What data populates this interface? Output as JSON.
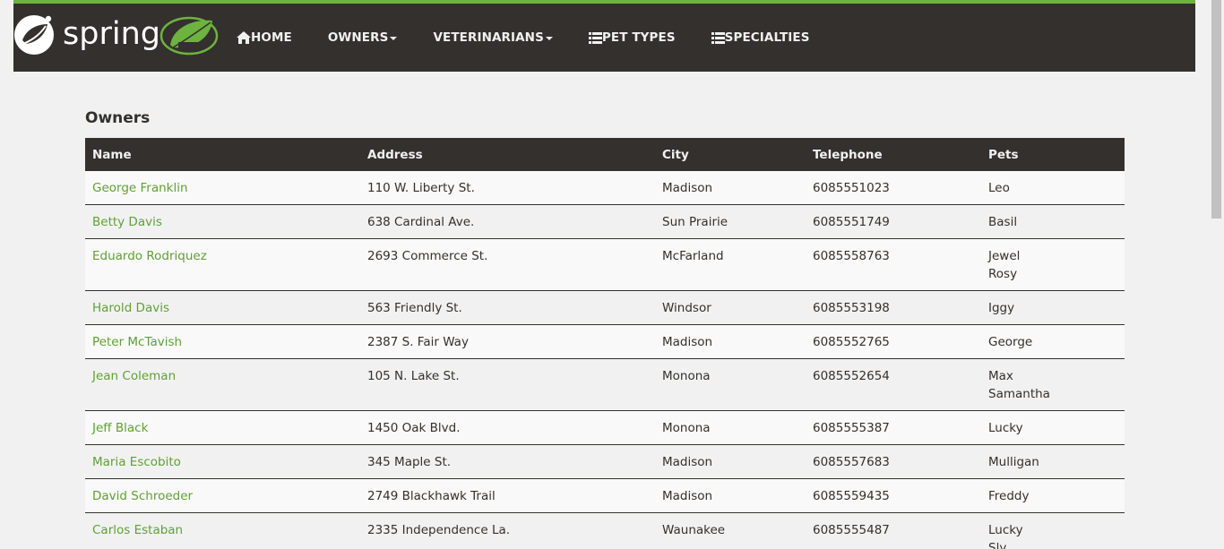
{
  "brand": {
    "wordmark": "spring"
  },
  "nav": {
    "items": [
      {
        "label": "HOME",
        "icon": "home-icon"
      },
      {
        "label": "OWNERS",
        "icon": "caret-down-icon"
      },
      {
        "label": "VETERINARIANS",
        "icon": "caret-down-icon"
      },
      {
        "label": "PET TYPES",
        "icon": "list-icon"
      },
      {
        "label": "SPECIALTIES",
        "icon": "list-icon"
      }
    ]
  },
  "page": {
    "title": "Owners"
  },
  "table": {
    "headers": [
      "Name",
      "Address",
      "City",
      "Telephone",
      "Pets"
    ],
    "rows": [
      {
        "name": "George Franklin",
        "address": "110 W. Liberty St.",
        "city": "Madison",
        "telephone": "6085551023",
        "pets": [
          "Leo"
        ]
      },
      {
        "name": "Betty Davis",
        "address": "638 Cardinal Ave.",
        "city": "Sun Prairie",
        "telephone": "6085551749",
        "pets": [
          "Basil"
        ]
      },
      {
        "name": "Eduardo Rodriquez",
        "address": "2693 Commerce St.",
        "city": "McFarland",
        "telephone": "6085558763",
        "pets": [
          "Jewel",
          "Rosy"
        ]
      },
      {
        "name": "Harold Davis",
        "address": "563 Friendly St.",
        "city": "Windsor",
        "telephone": "6085553198",
        "pets": [
          "Iggy"
        ]
      },
      {
        "name": "Peter McTavish",
        "address": "2387 S. Fair Way",
        "city": "Madison",
        "telephone": "6085552765",
        "pets": [
          "George"
        ]
      },
      {
        "name": "Jean Coleman",
        "address": "105 N. Lake St.",
        "city": "Monona",
        "telephone": "6085552654",
        "pets": [
          "Max",
          "Samantha"
        ]
      },
      {
        "name": "Jeff Black",
        "address": "1450 Oak Blvd.",
        "city": "Monona",
        "telephone": "6085555387",
        "pets": [
          "Lucky"
        ]
      },
      {
        "name": "Maria Escobito",
        "address": "345 Maple St.",
        "city": "Madison",
        "telephone": "6085557683",
        "pets": [
          "Mulligan"
        ]
      },
      {
        "name": "David Schroeder",
        "address": "2749 Blackhawk Trail",
        "city": "Madison",
        "telephone": "6085559435",
        "pets": [
          "Freddy"
        ]
      },
      {
        "name": "Carlos Estaban",
        "address": "2335 Independence La.",
        "city": "Waunakee",
        "telephone": "6085555487",
        "pets": [
          "Lucky",
          "Sly"
        ]
      }
    ]
  },
  "colors": {
    "nav_background": "#34302d",
    "accent_green": "#6db33f",
    "link_green": "#5fa134",
    "page_background": "#f1f1f1"
  }
}
